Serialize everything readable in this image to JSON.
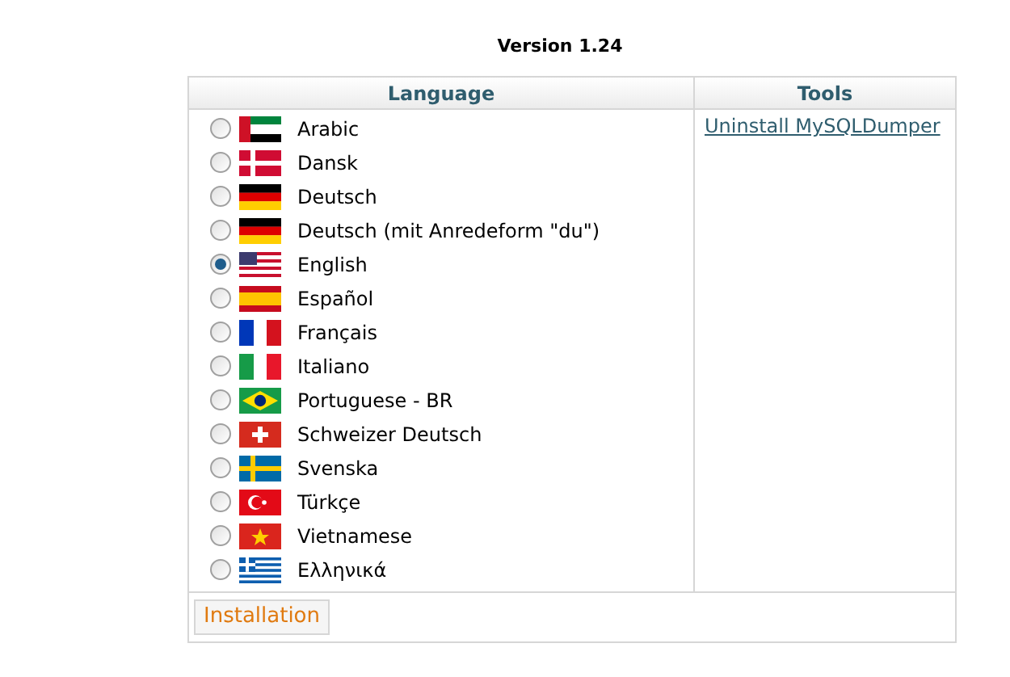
{
  "version": "Version 1.24",
  "table": {
    "columns": [
      "Language",
      "Tools"
    ],
    "languages": [
      {
        "label": "Arabic",
        "selected": false
      },
      {
        "label": "Dansk",
        "selected": false
      },
      {
        "label": "Deutsch",
        "selected": false
      },
      {
        "label": "Deutsch (mit Anredeform \"du\")",
        "selected": false
      },
      {
        "label": "English",
        "selected": true
      },
      {
        "label": "Español",
        "selected": false
      },
      {
        "label": "Français",
        "selected": false
      },
      {
        "label": "Italiano",
        "selected": false
      },
      {
        "label": "Portuguese - BR",
        "selected": false
      },
      {
        "label": "Schweizer Deutsch",
        "selected": false
      },
      {
        "label": "Svenska",
        "selected": false
      },
      {
        "label": "Türkçe",
        "selected": false
      },
      {
        "label": "Vietnamese",
        "selected": false
      },
      {
        "label": "Ελληνικά",
        "selected": false
      }
    ],
    "tools": [
      "Uninstall MySQLDumper"
    ]
  },
  "buttons": [
    "Installation"
  ]
}
